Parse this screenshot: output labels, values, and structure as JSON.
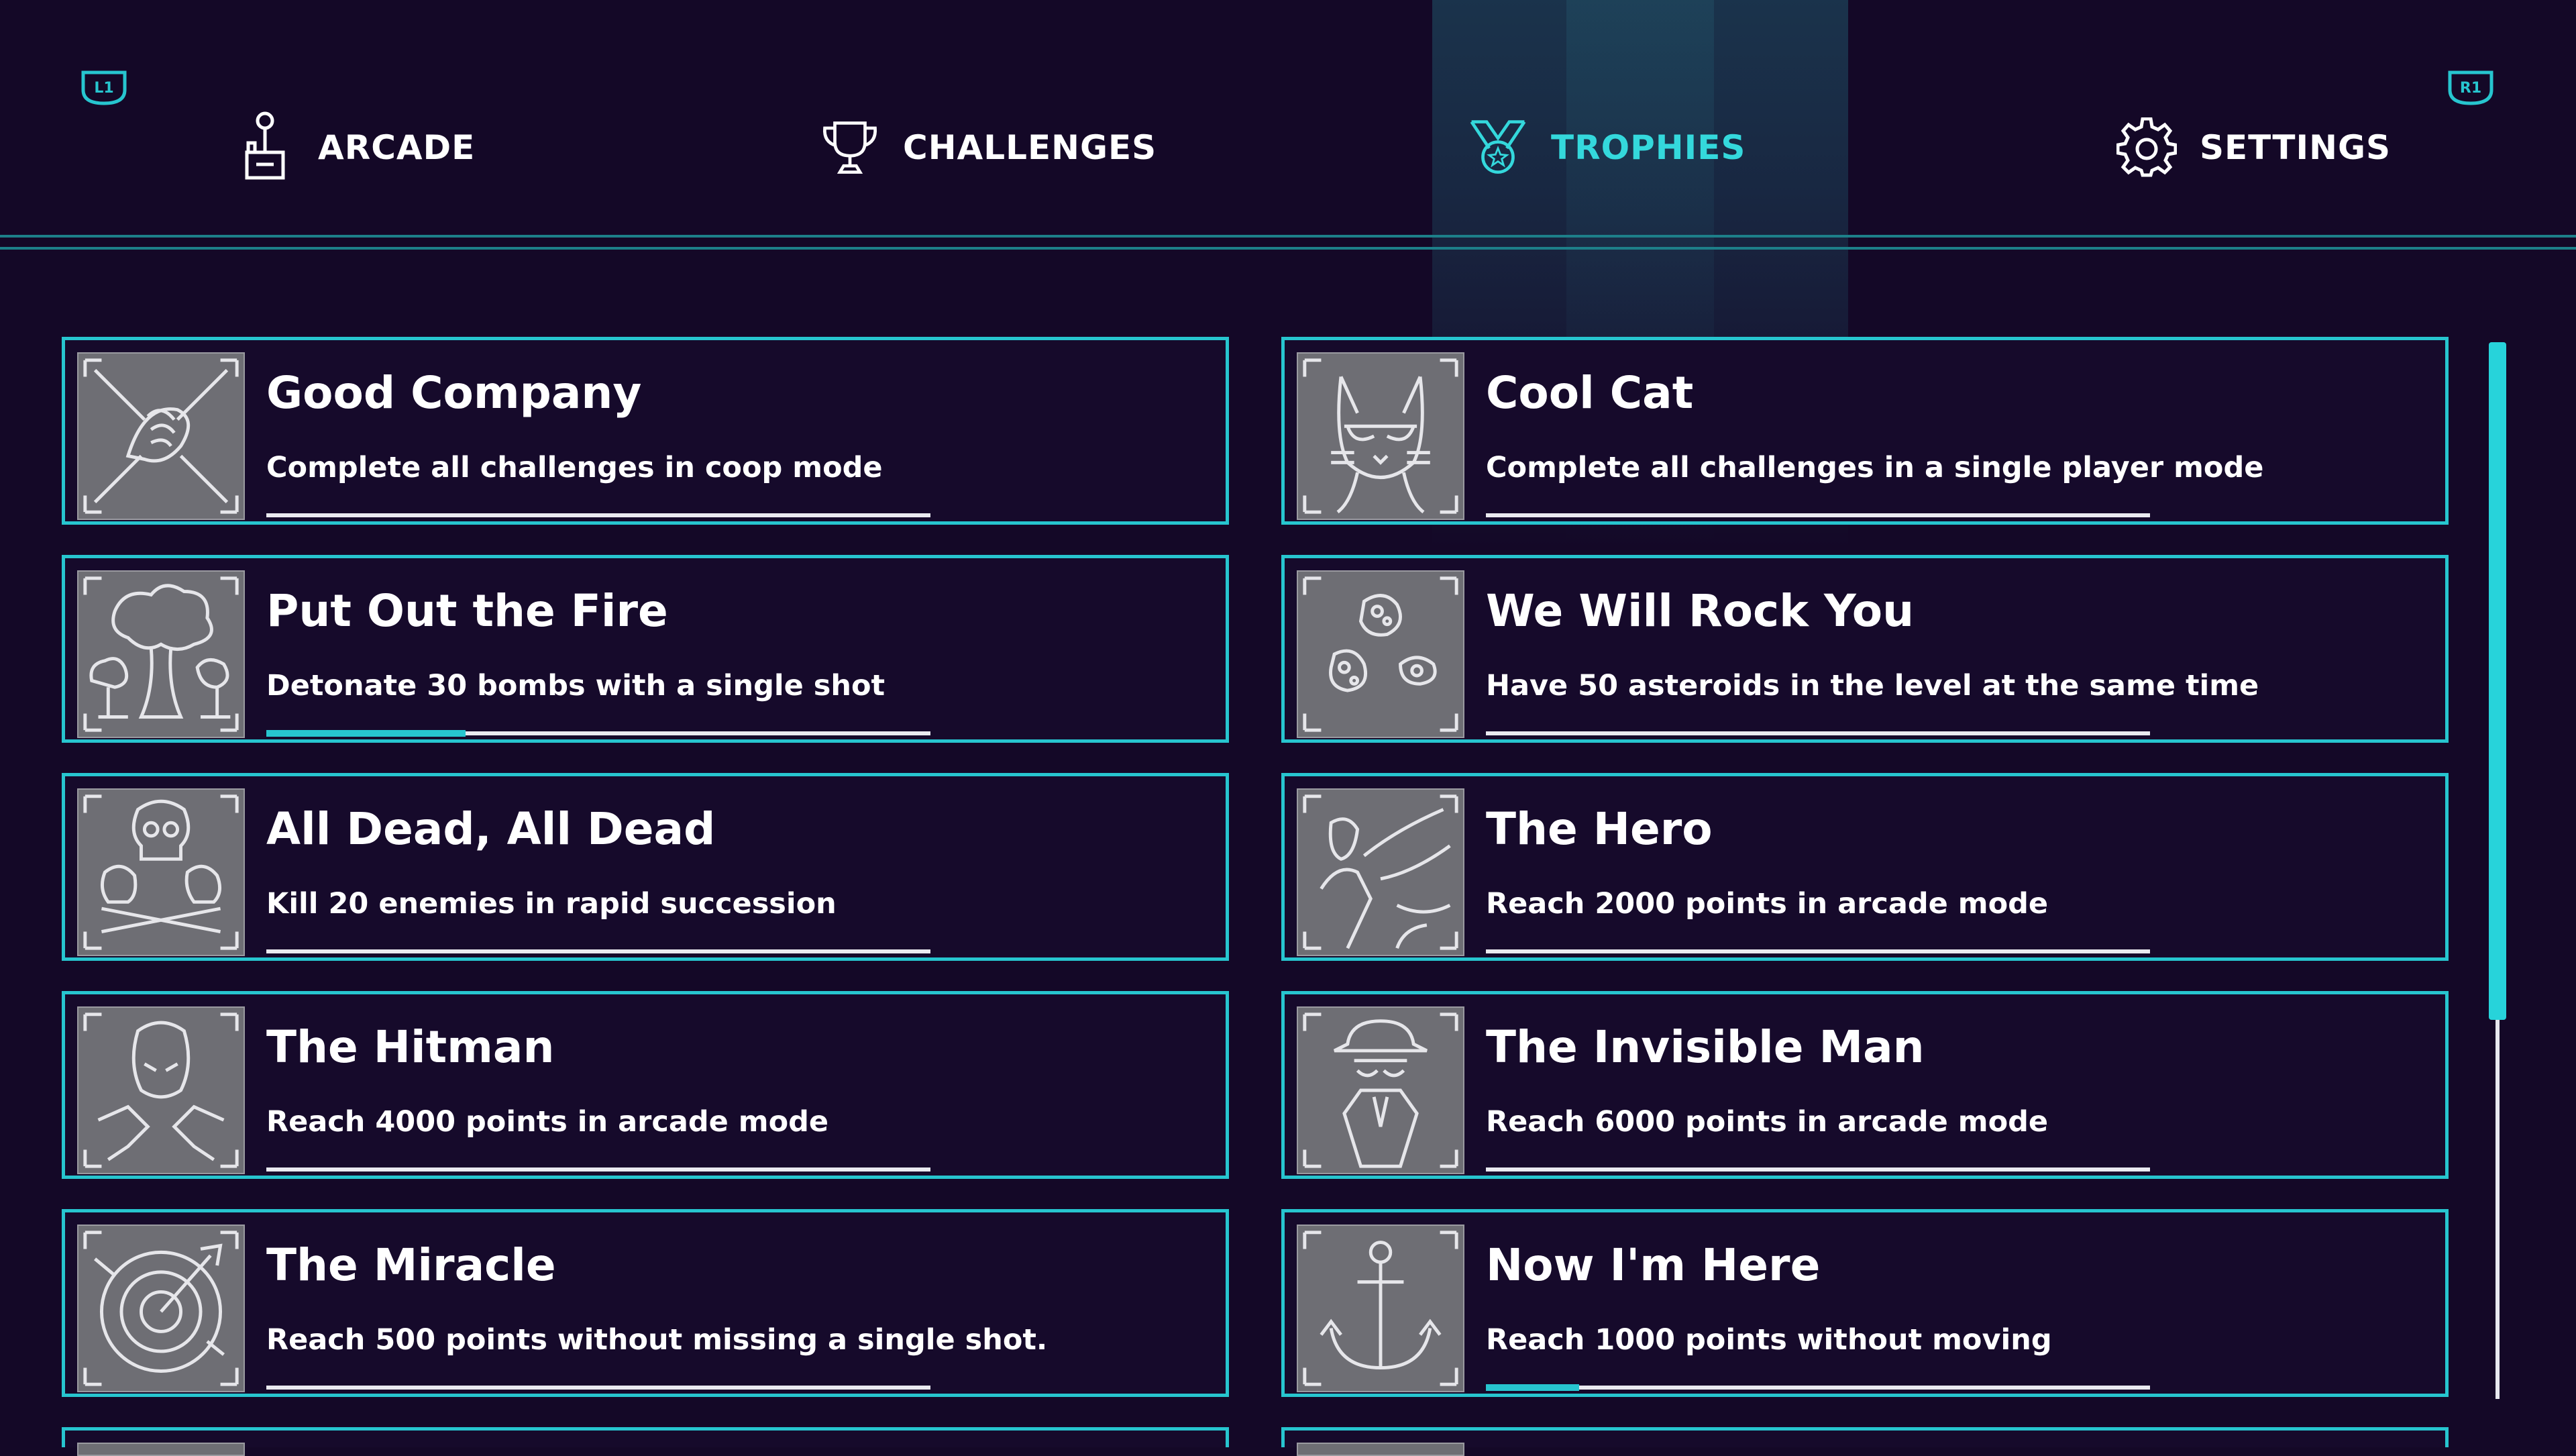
{
  "colors": {
    "background": "#140827",
    "accent": "#27c5cf",
    "active_tab": "#34d8dc",
    "text": "#ffffff",
    "thumbnail": "#6e6e74"
  },
  "shoulder_buttons": {
    "left": "L1",
    "right": "R1"
  },
  "tabs": [
    {
      "label": "ARCADE",
      "icon": "joystick-icon",
      "active": false
    },
    {
      "label": "CHALLENGES",
      "icon": "trophy-cup-icon",
      "active": false
    },
    {
      "label": "TROPHIES",
      "icon": "medal-icon",
      "active": true
    },
    {
      "label": "SETTINGS",
      "icon": "gear-icon",
      "active": false
    }
  ],
  "trophies": [
    {
      "title": "Good Company",
      "description": "Complete all challenges in coop mode",
      "progress": 0,
      "icon": "handshake-icon"
    },
    {
      "title": "Cool Cat",
      "description": "Complete all challenges in a single player mode",
      "progress": 0,
      "icon": "cat-sunglasses-icon"
    },
    {
      "title": "Put Out the Fire",
      "description": "Detonate 30 bombs with a single shot",
      "progress": 0.3,
      "icon": "explosion-icon"
    },
    {
      "title": "We Will Rock You",
      "description": "Have 50 asteroids in the level at the same time",
      "progress": 0,
      "icon": "asteroids-icon"
    },
    {
      "title": "All Dead, All Dead",
      "description": "Kill 20 enemies in rapid succession",
      "progress": 0,
      "icon": "skulls-icon"
    },
    {
      "title": "The Hero",
      "description": "Reach 2000 points in arcade mode",
      "progress": 0,
      "icon": "hero-icon"
    },
    {
      "title": "The Hitman",
      "description": "Reach 4000 points in arcade mode",
      "progress": 0,
      "icon": "hitman-icon"
    },
    {
      "title": "The Invisible Man",
      "description": "Reach 6000 points in arcade mode",
      "progress": 0,
      "icon": "invisible-man-icon"
    },
    {
      "title": "The Miracle",
      "description": "Reach 500 points without missing a single shot.",
      "progress": 0,
      "icon": "target-icon"
    },
    {
      "title": "Now I'm Here",
      "description": "Reach 1000 points without moving",
      "progress": 0.14,
      "icon": "anchor-icon"
    }
  ],
  "scrollbar": {
    "position": 0,
    "visible_fraction": 0.64
  }
}
